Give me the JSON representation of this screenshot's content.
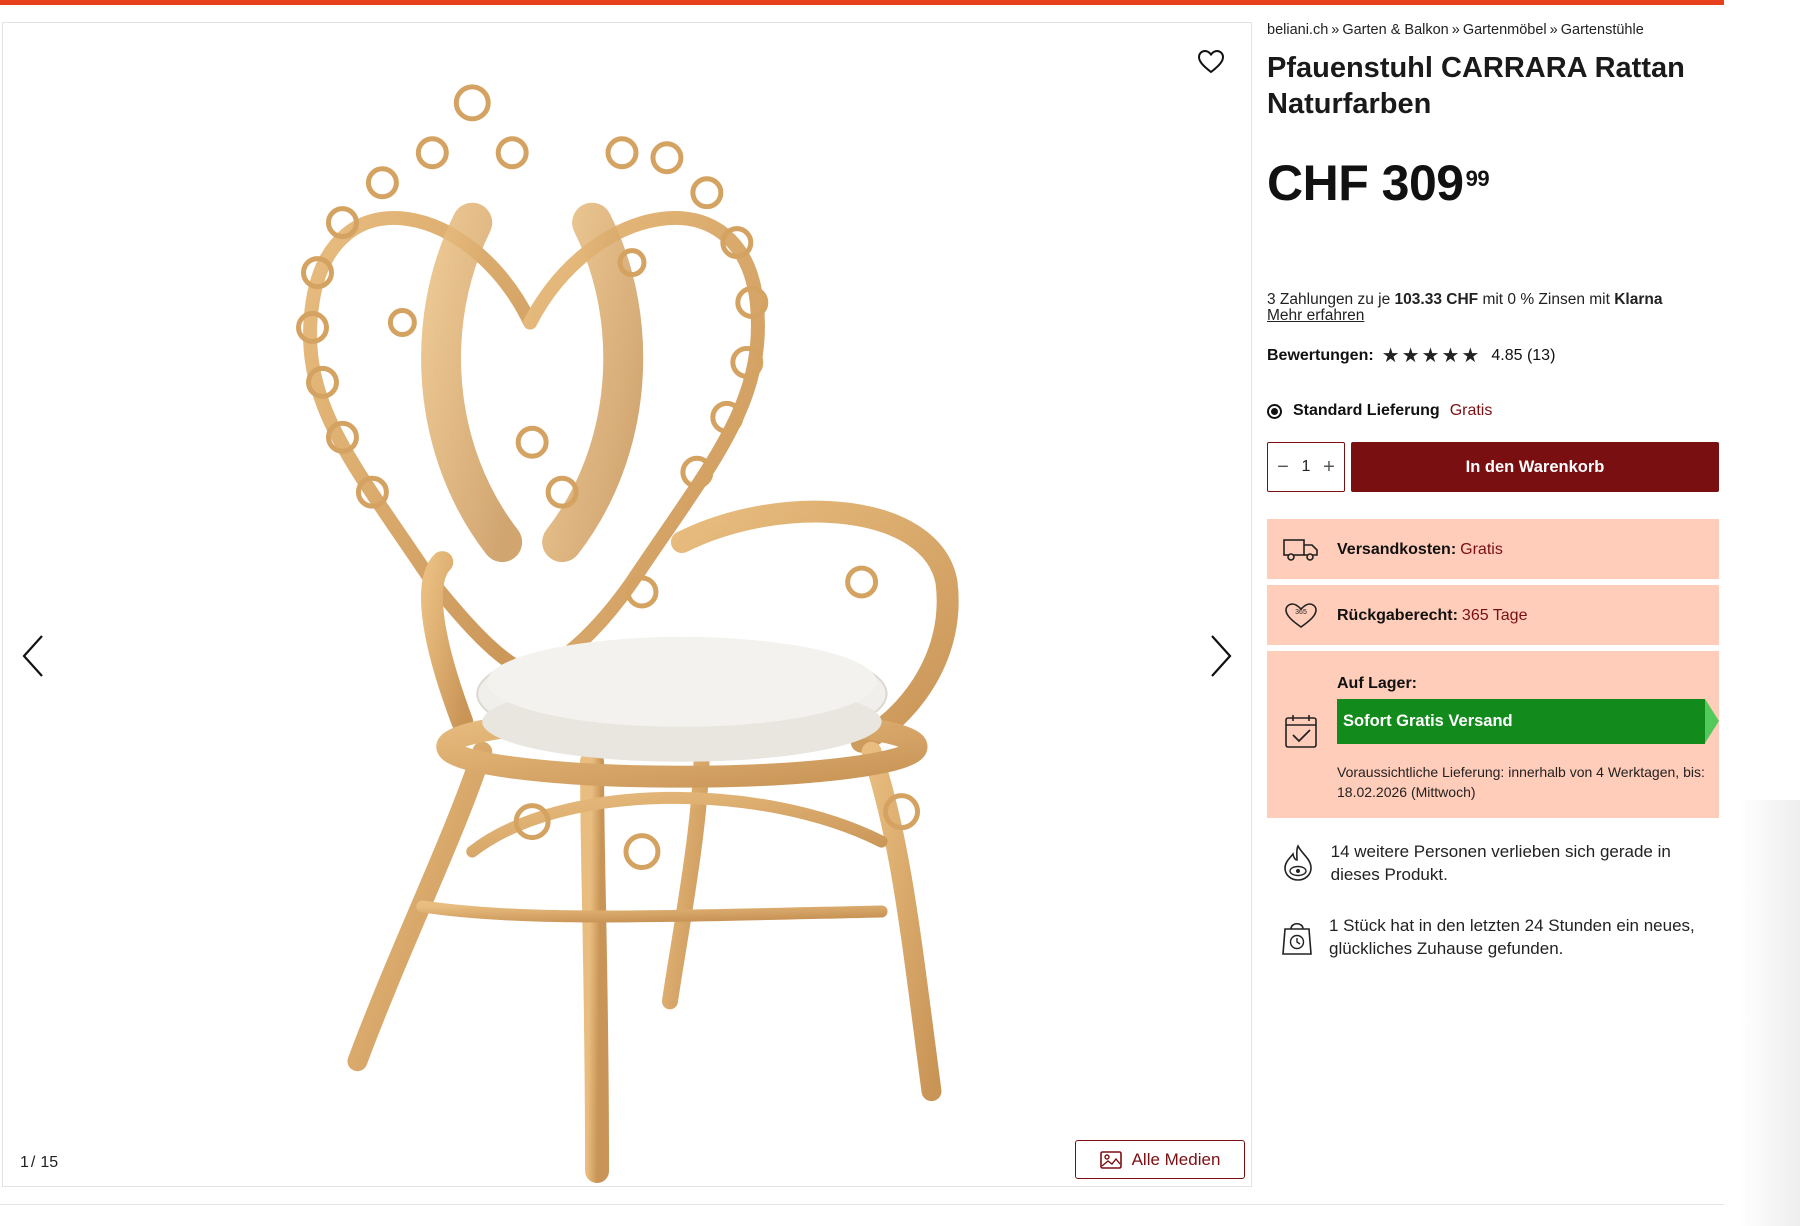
{
  "breadcrumb": {
    "items": [
      "beliani.ch",
      "Garten & Balkon",
      "Gartenmöbel",
      "Gartenstühle"
    ],
    "separator": "»"
  },
  "product": {
    "title": "Pfauenstuhl CARRARA Rattan Naturfarben",
    "price_main": "CHF 309",
    "price_cents": "99"
  },
  "klarna": {
    "prefix": "3 Zahlungen zu je",
    "amount": "103.33 CHF",
    "middle": "mit 0 % Zinsen mit",
    "brand": "Klarna",
    "link": "Mehr erfahren"
  },
  "rating": {
    "label": "Bewertungen:",
    "stars": 5,
    "value_text": "4.85 (13)"
  },
  "delivery": {
    "option": "Standard Lieferung",
    "price": "Gratis"
  },
  "cart": {
    "quantity": "1",
    "minus": "−",
    "plus": "+",
    "button_label": "In den Warenkorb"
  },
  "info": {
    "shipping_label": "Versandkosten:",
    "shipping_value": "Gratis",
    "return_label": "Rückgaberecht:",
    "return_value": "365 Tage",
    "return_badge": "365",
    "stock_label": "Auf Lager:",
    "stock_banner": "Sofort Gratis Versand",
    "eta": "Voraussichtliche Lieferung: innerhalb von 4 Werktagen, bis: 18.02.2026 (Mittwoch)"
  },
  "social": {
    "love": "14 weitere Personen verlieben sich gerade in dieses Produkt.",
    "sold": "1 Stück hat in den letzten 24 Stunden ein neues, glückliches Zuhause gefunden."
  },
  "gallery": {
    "current": "1",
    "total": "15",
    "all_media_label": "Alle Medien"
  },
  "colors": {
    "accent": "#7a0f12",
    "top_bar": "#e8401c",
    "info_bg": "#ffcdb9",
    "stock_green": "#138a1c",
    "rattan": "#d9a966"
  },
  "icons": [
    "heart-icon",
    "chevron-left-icon",
    "chevron-right-icon",
    "image-icon",
    "truck-icon",
    "return-heart-icon",
    "calendar-check-icon",
    "flame-eye-icon",
    "shopping-bag-clock-icon",
    "star-icon"
  ]
}
